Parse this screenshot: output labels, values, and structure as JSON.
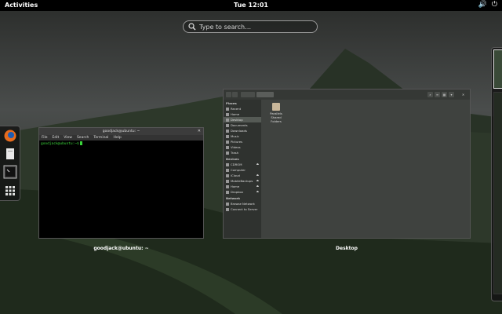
{
  "topbar": {
    "activities": "Activities",
    "clock": "Tue 12:01"
  },
  "search": {
    "placeholder": "Type to search…"
  },
  "terminal": {
    "title": "goodjack@ubuntu: ~",
    "menu": [
      "File",
      "Edit",
      "View",
      "Search",
      "Terminal",
      "Help"
    ],
    "prompt": "goodjack@ubuntu:~$",
    "caption": "goodjack@ubuntu: ~"
  },
  "files": {
    "caption": "Desktop",
    "sidebar": {
      "places_heading": "Places",
      "places": [
        "Recent",
        "Home",
        "Desktop",
        "Documents",
        "Downloads",
        "Music",
        "Pictures",
        "Videos",
        "Trash"
      ],
      "devices_heading": "Devices",
      "devices": [
        "CDROM",
        "Computer",
        "iCloud",
        "MobileBackups",
        "Home",
        "Dropbox"
      ],
      "network_heading": "Network",
      "network": [
        "Browse Network",
        "Connect to Server"
      ]
    },
    "items": [
      {
        "name": "Parallels Shared Folders"
      }
    ]
  },
  "colors": {
    "accent": "#3bd43b",
    "topbar": "#000000"
  }
}
